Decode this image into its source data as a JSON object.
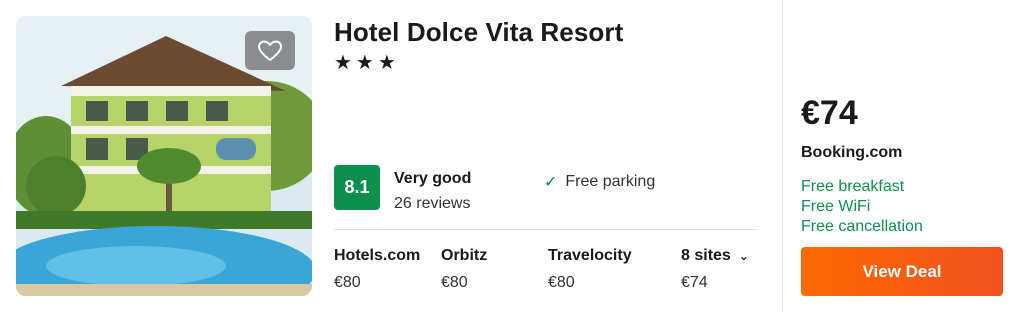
{
  "hotel": {
    "name": "Hotel Dolce Vita Resort",
    "stars_text": "★★★",
    "star_count": 3
  },
  "rating": {
    "score": "8.1",
    "label": "Very good",
    "reviews": "26 reviews"
  },
  "amenities": [
    {
      "label": "Free parking",
      "icon": "check-icon"
    }
  ],
  "sites": [
    {
      "name": "Hotels.com",
      "price": "€80"
    },
    {
      "name": "Orbitz",
      "price": "€80"
    },
    {
      "name": "Travelocity",
      "price": "€80"
    }
  ],
  "more_sites": {
    "label": "8 sites",
    "price": "€74",
    "icon": "chevron-down-icon"
  },
  "deal": {
    "price": "€74",
    "provider": "Booking.com",
    "perks": [
      "Free breakfast",
      "Free WiFi",
      "Free cancellation"
    ],
    "button_label": "View Deal"
  },
  "icons": {
    "favorite": "heart-icon",
    "check": "check-icon",
    "chevron": "chevron-down-icon"
  },
  "colors": {
    "rating_green": "#0d8f4e",
    "cta_orange": "#ff6a00",
    "perk_green": "#0d8f4e"
  }
}
